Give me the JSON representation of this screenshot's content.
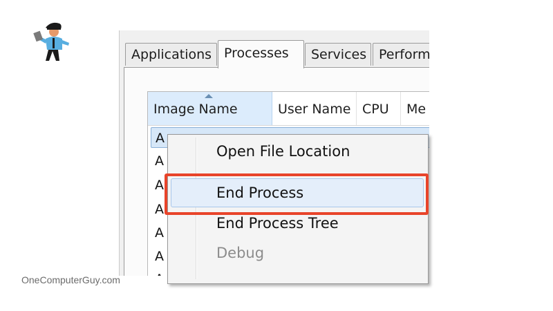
{
  "logo": {
    "icon": "person-with-laptop-icon",
    "colors": [
      "#1a1a1a",
      "#58aee0",
      "#e69a6a",
      "#7a7a7a"
    ]
  },
  "watermark": {
    "text": "OneComputerGuy.com"
  },
  "tabs": [
    {
      "label": "Applications",
      "active": false
    },
    {
      "label": "Processes",
      "active": true
    },
    {
      "label": "Services",
      "active": false
    },
    {
      "label": "Perform",
      "active": false
    }
  ],
  "list": {
    "columns": [
      {
        "label": "Image Name",
        "sorted": true
      },
      {
        "label": "User Name",
        "sorted": false
      },
      {
        "label": "CPU",
        "sorted": false
      },
      {
        "label": "Me",
        "sorted": false
      }
    ],
    "rows": [
      "A",
      "A",
      "A",
      "A",
      "A",
      "A",
      "A"
    ]
  },
  "context_menu": {
    "items": [
      {
        "label": "Open File Location",
        "enabled": true
      },
      {
        "label": "End Process",
        "enabled": true,
        "hovered": true
      },
      {
        "label": "End Process Tree",
        "enabled": true
      },
      {
        "label": "Debug",
        "enabled": false
      }
    ]
  },
  "colors": {
    "callout": "#e8442a",
    "hover": "#e4eefa",
    "sorted_header": "#dcecfc"
  }
}
